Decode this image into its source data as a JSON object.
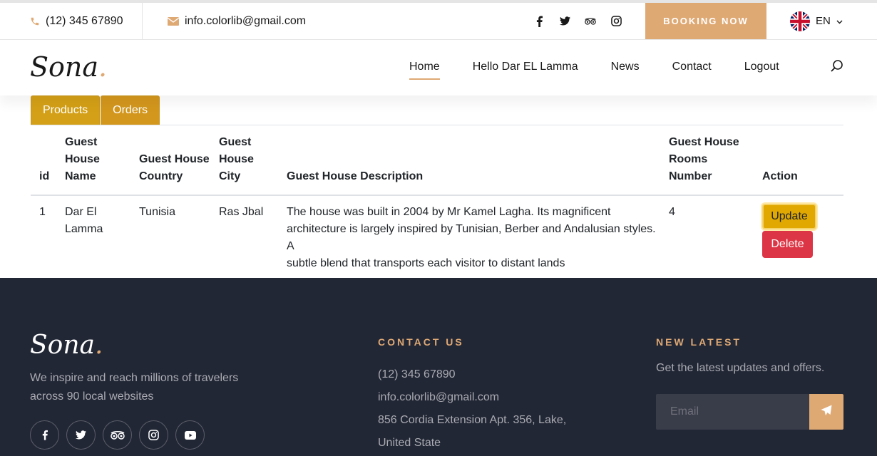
{
  "topbar": {
    "phone": "(12) 345 67890",
    "email": "info.colorlib@gmail.com",
    "social_icons": [
      "facebook-icon",
      "twitter-icon",
      "tripadvisor-icon",
      "instagram-icon"
    ],
    "booking_label": "Booking Now",
    "language": "EN"
  },
  "header": {
    "logo": "Sona",
    "logo_dot": ".",
    "nav": [
      "Home",
      "Hello Dar EL Lamma",
      "News",
      "Contact",
      "Logout"
    ]
  },
  "tabs": [
    "Products",
    "Orders"
  ],
  "table": {
    "headers": {
      "id": "id",
      "name": [
        "Guest",
        "House",
        "Name"
      ],
      "country": [
        "Guest House",
        "Country"
      ],
      "city": [
        "Guest",
        "House",
        "City"
      ],
      "description": "Guest House Description",
      "rooms": [
        "Guest House",
        "Rooms",
        "Number"
      ],
      "action": "Action"
    },
    "row": {
      "id": "1",
      "name": [
        "Dar El",
        "Lamma"
      ],
      "country": "Tunisia",
      "city": "Ras Jbal",
      "description": [
        "The house was built in 2004 by Mr Kamel Lagha. Its magnificent",
        "architecture is largely inspired by Tunisian, Berber and Andalusian styles. A",
        "subtle blend that transports each visitor to distant lands"
      ],
      "rooms": "4",
      "update_label": "Update",
      "delete_label": "Delete"
    }
  },
  "footer": {
    "logo": "Sona",
    "logo_dot": ".",
    "tagline": [
      "We inspire and reach millions of travelers",
      "across 90 local websites"
    ],
    "social_icons": [
      "facebook-icon",
      "twitter-icon",
      "tripadvisor-icon",
      "instagram-icon",
      "youtube-icon"
    ],
    "contact_heading": "Contact Us",
    "contact_lines": [
      "(12) 345 67890",
      "info.colorlib@gmail.com",
      "856 Cordia Extension Apt. 356, Lake,",
      "United State"
    ],
    "news_heading": "New Latest",
    "news_text": "Get the latest updates and offers.",
    "email_placeholder": "Email"
  },
  "colors": {
    "accent": "#dfa974",
    "tab": "#d4a017",
    "footer": "#222736",
    "update": "#e0a800",
    "delete": "#dc3545"
  }
}
